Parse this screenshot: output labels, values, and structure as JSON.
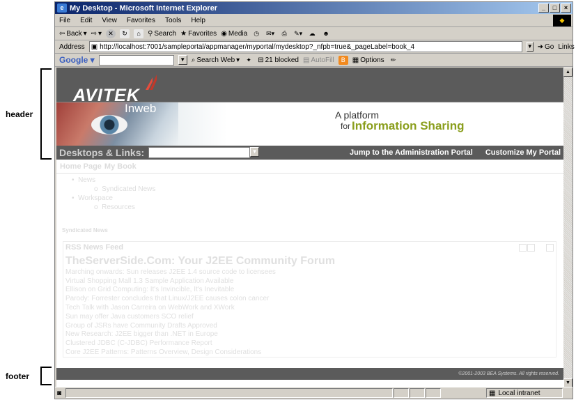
{
  "annotations": {
    "header": "header",
    "footer": "footer"
  },
  "window": {
    "title": "My Desktop - Microsoft Internet Explorer",
    "menu": [
      "File",
      "Edit",
      "View",
      "Favorites",
      "Tools",
      "Help"
    ]
  },
  "toolbar": {
    "back": "Back",
    "search": "Search",
    "favorites": "Favorites",
    "media": "Media"
  },
  "address": {
    "label": "Address",
    "url": "http://localhost:7001/sampleportal/appmanager/myportal/mydesktop?_nfpb=true&_pageLabel=book_4",
    "go": "Go",
    "links": "Links"
  },
  "google_bar": {
    "logo": "Google",
    "search_web": "Search Web",
    "blocked": "21 blocked",
    "autofill": "AutoFill",
    "options": "Options"
  },
  "portal": {
    "logo": "AVITEK",
    "product": "Inweb",
    "tagline_1": "A platform",
    "tagline_for": "for",
    "tagline_2": "Information Sharing",
    "desktops_label": "Desktops & Links:",
    "jump_link": "Jump to the Administration Portal",
    "customize_link": "Customize My Portal",
    "page_tabs": [
      "Home Page",
      "My Book"
    ],
    "tree": {
      "news": "News",
      "syndicated_news": "Syndicated News",
      "workspace": "Workspace",
      "resources": "Resources"
    },
    "section_title": "Syndicated News",
    "rss": {
      "title": "RSS News Feed",
      "forum": "TheServerSide.Com: Your J2EE Community Forum",
      "items": [
        "Marching onwards: Sun releases J2EE 1.4 source code to licensees",
        "Virtual Shopping Mall 1.3 Sample Application Available",
        "Ellison on Grid Computing: It's Invincible, It's Inevitable",
        "Parody: Forrester concludes that Linux/J2EE causes colon cancer",
        "Tech Talk with Jason Carreira on WebWork and XWork",
        "Sun may offer Java customers SCO relief",
        "Group of JSRs have Community Drafts Approved",
        "New Research: J2EE bigger than .NET in Europe",
        "Clustered JDBC (C-JDBC) Performance Report",
        "Core J2EE Patterns: Patterns Overview, Design Considerations"
      ]
    },
    "footer": "©2001-2003 BEA Systems. All rights reserved."
  },
  "status_bar": {
    "zone": "Local intranet"
  }
}
